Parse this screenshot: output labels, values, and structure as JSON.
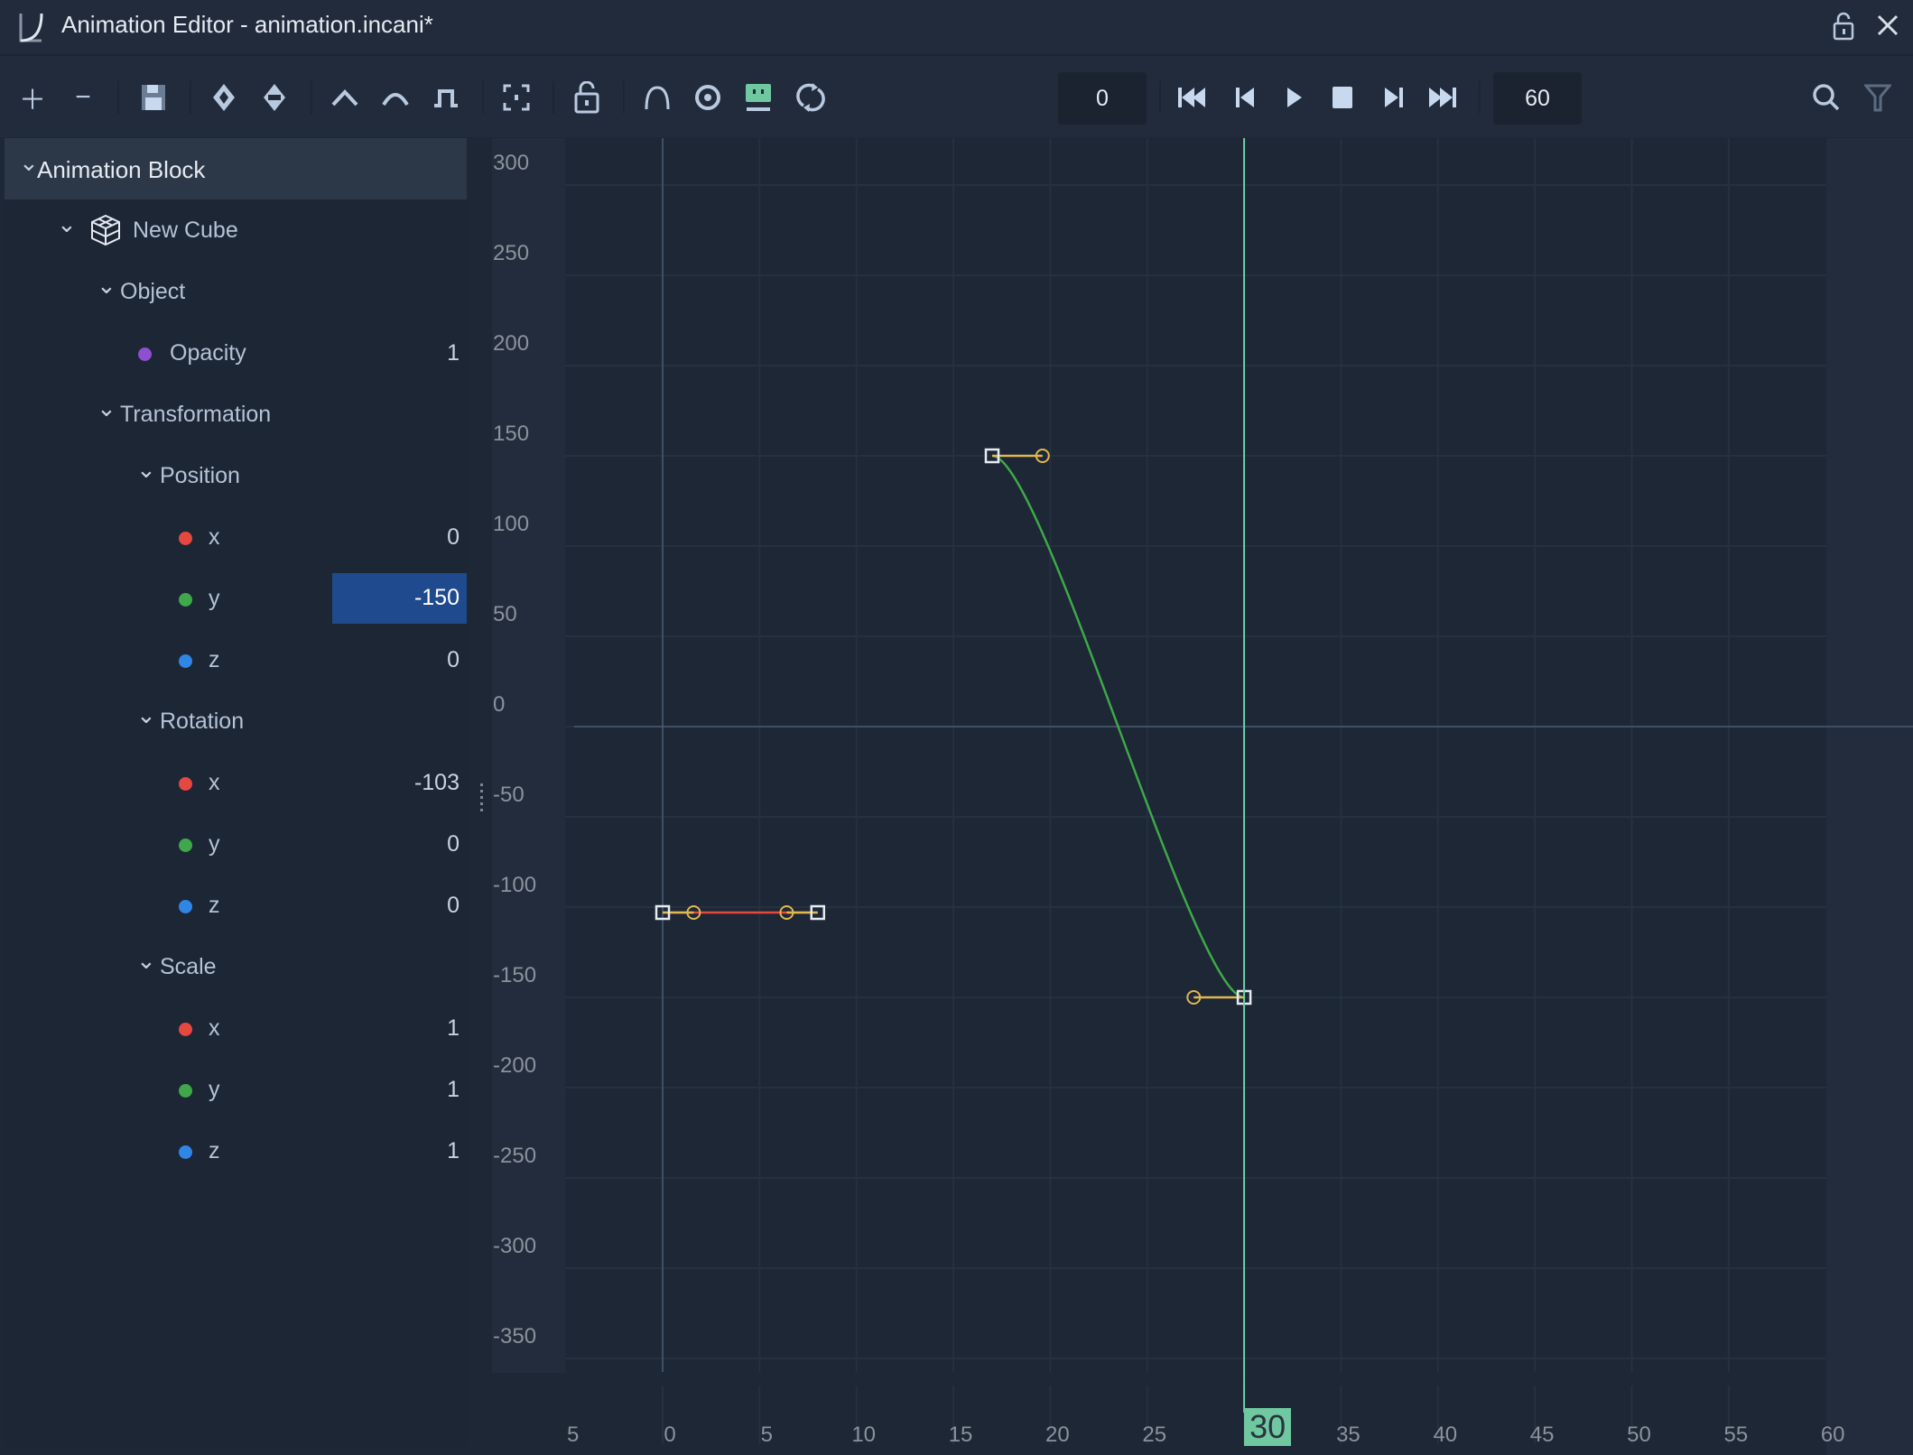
{
  "window": {
    "title": "Animation Editor - animation.incani*",
    "icons": [
      "app-logo-icon",
      "lock-icon",
      "close-icon"
    ]
  },
  "toolbar": {
    "icons": [
      "plus-icon",
      "minus-icon",
      "save-icon",
      "add-keyframe-icon",
      "remove-keyframe-icon",
      "smooth-curve-icon",
      "auto-curve-icon",
      "step-curve-icon",
      "fit-view-icon",
      "lock-icon",
      "arc-icon",
      "eye-icon",
      "monitor-icon",
      "loop-icon",
      "skip-start-icon",
      "step-back-icon",
      "play-icon",
      "stop-icon",
      "step-forward-icon",
      "skip-end-icon",
      "search-icon",
      "filter-icon"
    ],
    "start_frame": "0",
    "end_frame": "60"
  },
  "tree": [
    {
      "label": "Animation Block",
      "level": 0,
      "chevron": true
    },
    {
      "label": "New Cube",
      "level": 1,
      "chevron": true,
      "icon": "cube-icon"
    },
    {
      "label": "Object",
      "level": 2,
      "chevron": true
    },
    {
      "label": "Opacity",
      "level": 3,
      "dot": "#8e4fd0",
      "value": "1"
    },
    {
      "label": "Transformation",
      "level": 2,
      "chevron": true
    },
    {
      "label": "Position",
      "level": 3,
      "chevron": true
    },
    {
      "label": "x",
      "level": 4,
      "dot": "#e5483f",
      "value": "0"
    },
    {
      "label": "y",
      "level": 4,
      "dot": "#3fa84a",
      "value": "-150",
      "selected": true
    },
    {
      "label": "z",
      "level": 4,
      "dot": "#2f86e6",
      "value": "0"
    },
    {
      "label": "Rotation",
      "level": 3,
      "chevron": true
    },
    {
      "label": "x",
      "level": 4,
      "dot": "#e5483f",
      "value": "-103"
    },
    {
      "label": "y",
      "level": 4,
      "dot": "#3fa84a",
      "value": "0"
    },
    {
      "label": "z",
      "level": 4,
      "dot": "#2f86e6",
      "value": "0"
    },
    {
      "label": "Scale",
      "level": 3,
      "chevron": true
    },
    {
      "label": "x",
      "level": 4,
      "dot": "#e5483f",
      "value": "1"
    },
    {
      "label": "y",
      "level": 4,
      "dot": "#3fa84a",
      "value": "1"
    },
    {
      "label": "z",
      "level": 4,
      "dot": "#2f86e6",
      "value": "1"
    }
  ],
  "chart_data": {
    "type": "line",
    "xlim": [
      -5,
      60
    ],
    "ylim": [
      -350,
      300
    ],
    "x_ticks": [
      "5",
      "0",
      "5",
      "10",
      "15",
      "20",
      "25",
      "30",
      "35",
      "40",
      "45",
      "50",
      "55",
      "60"
    ],
    "x_tick_values": [
      -5,
      0,
      5,
      10,
      15,
      20,
      25,
      30,
      35,
      40,
      45,
      50,
      55,
      60
    ],
    "y_ticks": [
      "300",
      "250",
      "200",
      "150",
      "100",
      "50",
      "0",
      "-50",
      "-100",
      "-150",
      "-200",
      "-250",
      "-300",
      "-350"
    ],
    "y_tick_values": [
      300,
      250,
      200,
      150,
      100,
      50,
      0,
      -50,
      -100,
      -150,
      -200,
      -250,
      -300,
      -350
    ],
    "current_frame": "30",
    "current_frame_value": 30,
    "grid": true,
    "series": [
      {
        "color": "#e5483f",
        "keyframes": [
          {
            "x": 0,
            "y": -103,
            "out": [
              1.6,
              -103
            ]
          },
          {
            "x": 8,
            "y": -103,
            "in": [
              6.4,
              -103
            ]
          }
        ]
      },
      {
        "color": "#3fa84a",
        "keyframes": [
          {
            "x": 17,
            "y": 150,
            "out": [
              19.6,
              150
            ]
          },
          {
            "x": 30,
            "y": -150,
            "in": [
              27.4,
              -150
            ]
          }
        ]
      }
    ],
    "handle_color": "#e0b850",
    "playhead_color": "#6fd0a8"
  }
}
